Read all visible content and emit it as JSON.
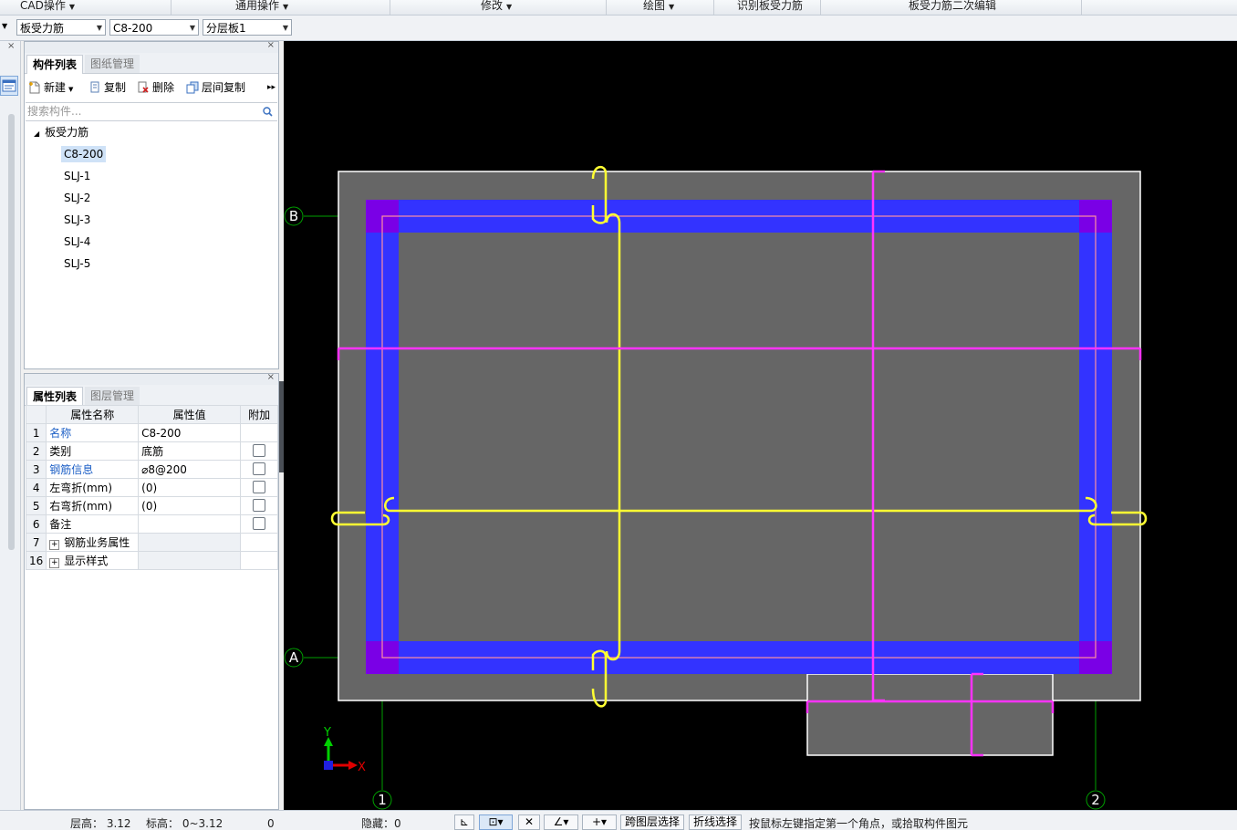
{
  "menubar": {
    "cad_ops": "CAD操作",
    "common_ops": "通用操作",
    "modify": "修改",
    "draw": "绘图",
    "identify": "识别板受力筋",
    "edit": "板受力筋二次编辑"
  },
  "toolbar2": {
    "type_select": "板受力筋",
    "component_select": "C8-200",
    "layer_select": "分层板1"
  },
  "component_panel": {
    "tab_active": "构件列表",
    "tab_other": "图纸管理",
    "new_label": "新建",
    "copy_label": "复制",
    "delete_label": "删除",
    "layer_copy_label": "层间复制",
    "search_placeholder": "搜索构件...",
    "tree_root": "板受力筋",
    "items": [
      "C8-200",
      "SLJ-1",
      "SLJ-2",
      "SLJ-3",
      "SLJ-4",
      "SLJ-5"
    ]
  },
  "property_panel": {
    "tab_active": "属性列表",
    "tab_other": "图层管理",
    "col_name": "属性名称",
    "col_value": "属性值",
    "col_extra": "附加",
    "rows": [
      {
        "num": "1",
        "name": "名称",
        "value": "C8-200"
      },
      {
        "num": "2",
        "name": "类别",
        "value": "底筋"
      },
      {
        "num": "3",
        "name": "钢筋信息",
        "value": "⌀8@200"
      },
      {
        "num": "4",
        "name": "左弯折(mm)",
        "value": "(0)"
      },
      {
        "num": "5",
        "name": "右弯折(mm)",
        "value": "(0)"
      },
      {
        "num": "6",
        "name": "备注",
        "value": ""
      },
      {
        "num": "7",
        "name": "钢筋业务属性",
        "value": ""
      },
      {
        "num": "16",
        "name": "显示样式",
        "value": ""
      }
    ]
  },
  "canvas": {
    "axis_b": "B",
    "axis_a": "A",
    "axis_1": "1",
    "axis_2": "2",
    "ucs_y": "Y",
    "ucs_x": "X",
    "colors": {
      "background": "#000000",
      "slab": "#666666",
      "beam": "#3333ff",
      "column": "#7a00e6",
      "rebar_bottom": "#ffff33",
      "rebar_top": "#ff33ff",
      "grid_line": "#00a000"
    }
  },
  "statusbar": {
    "floor_height": "层高： 3.12",
    "elevation": "标高： 0~3.12",
    "zero": "0",
    "hidden": "隐藏：0",
    "cross_layer_select": "跨图层选择",
    "polyline_select": "折线选择",
    "hint": "按鼠标左键指定第一个角点，或拾取构件图元"
  }
}
